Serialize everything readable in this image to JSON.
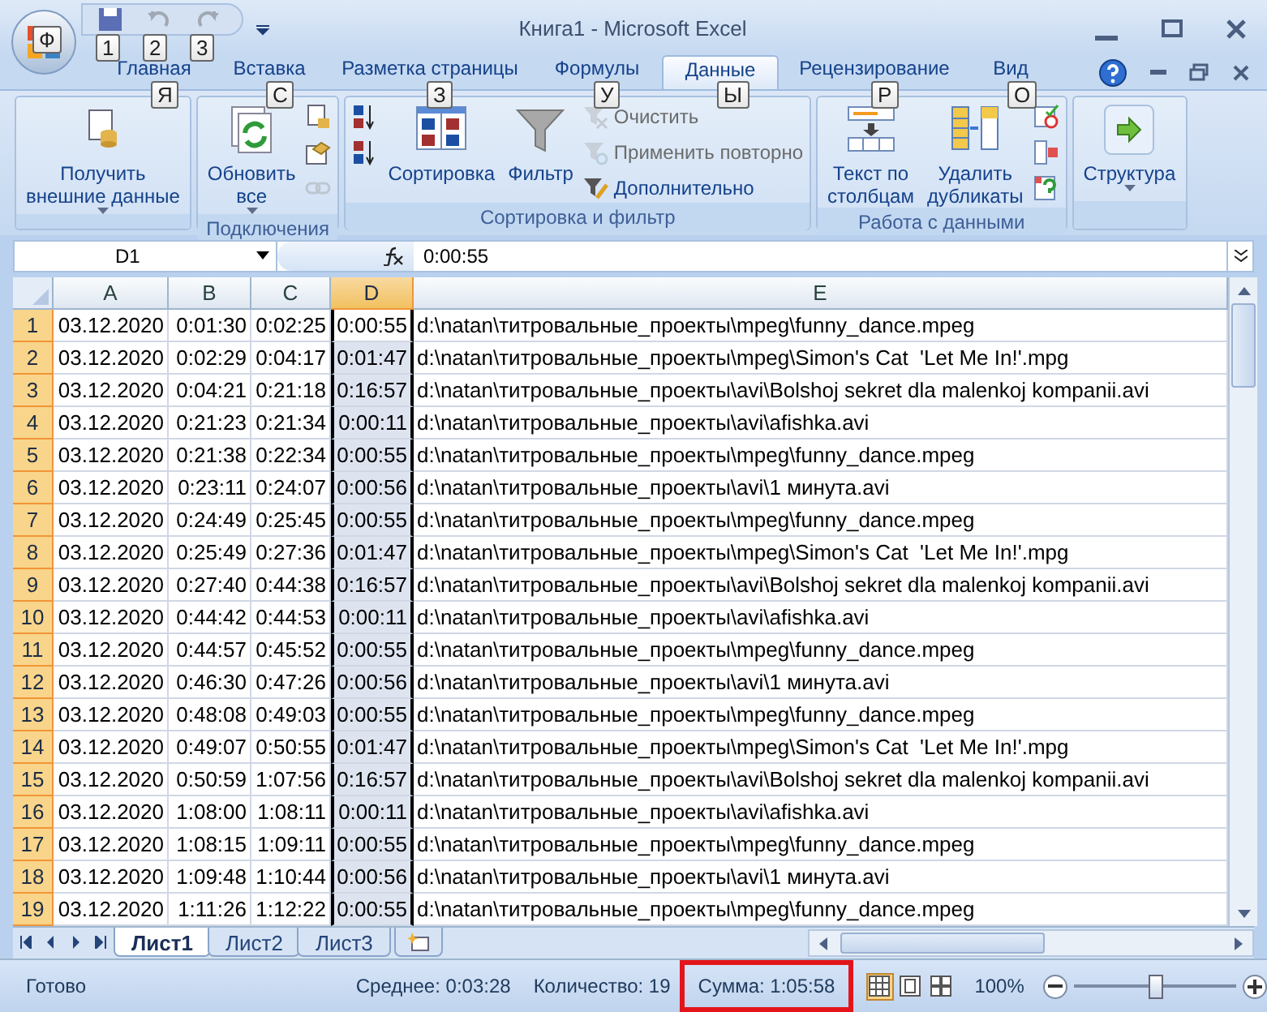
{
  "app_button": {
    "keytip": "Ф"
  },
  "quick_access": [
    {
      "keytip": "1",
      "disabled": false
    },
    {
      "keytip": "2",
      "disabled": true
    },
    {
      "keytip": "3",
      "disabled": true
    }
  ],
  "title": "Книга1 - Microsoft Excel",
  "tabs": [
    {
      "label": "Главная",
      "selected": false,
      "keytip": "Я"
    },
    {
      "label": "Вставка",
      "selected": false,
      "keytip": "С"
    },
    {
      "label": "Разметка страницы",
      "selected": false,
      "keytip": "З"
    },
    {
      "label": "Формулы",
      "selected": false,
      "keytip": "У"
    },
    {
      "label": "Данные",
      "selected": true,
      "keytip": "Ы"
    },
    {
      "label": "Рецензирование",
      "selected": false,
      "keytip": "Р"
    },
    {
      "label": "Вид",
      "selected": false,
      "keytip": "О"
    }
  ],
  "ribbon_groups": [
    {
      "items": [
        {
          "kind": "large",
          "label": "Получить\nвнешние данные",
          "dropdown": true,
          "disabled": false
        }
      ]
    },
    {
      "label": "Подключения",
      "items": [
        {
          "kind": "large",
          "label": "Обновить\nвсе",
          "dropdown": true,
          "disabled": false
        },
        {
          "kind": "icon",
          "disabled": false
        },
        {
          "kind": "icon",
          "disabled": false
        },
        {
          "kind": "icon",
          "disabled": true
        }
      ]
    },
    {
      "label": "Сортировка и фильтр",
      "items": [
        {
          "kind": "icon",
          "disabled": false
        },
        {
          "kind": "icon",
          "disabled": false
        },
        {
          "kind": "large",
          "label": "Сортировка",
          "disabled": false
        },
        {
          "kind": "large",
          "label": "Фильтр",
          "disabled": false
        },
        {
          "kind": "small",
          "label": "Очистить",
          "disabled": true
        },
        {
          "kind": "small",
          "label": "Применить повторно",
          "disabled": true
        },
        {
          "kind": "small",
          "label": "Дополнительно",
          "disabled": false
        }
      ]
    },
    {
      "label": "Работа с данными",
      "items": [
        {
          "kind": "large",
          "label": "Текст по\nстолбцам",
          "disabled": false
        },
        {
          "kind": "large",
          "label": "Удалить\nдубликаты",
          "disabled": false
        },
        {
          "kind": "icon",
          "disabled": false
        },
        {
          "kind": "icon",
          "disabled": false
        },
        {
          "kind": "icon",
          "disabled": false
        }
      ]
    },
    {
      "items": [
        {
          "kind": "large",
          "label": "Структура",
          "dropdown": true,
          "disabled": false
        }
      ]
    }
  ],
  "name_box": "D1",
  "formula": "0:00:55",
  "columns": [
    {
      "label": "A",
      "selected": false
    },
    {
      "label": "B",
      "selected": false
    },
    {
      "label": "C",
      "selected": false
    },
    {
      "label": "D",
      "selected": true
    },
    {
      "label": "E",
      "selected": false
    }
  ],
  "rows": [
    {
      "header": "1",
      "selected": true,
      "cells": [
        "03.12.2020",
        "0:01:30",
        "0:02:25",
        "0:00:55",
        "d:\\natan\\титровальные_проекты\\mpeg\\funny_dance.mpeg"
      ]
    },
    {
      "header": "2",
      "selected": true,
      "cells": [
        "03.12.2020",
        "0:02:29",
        "0:04:17",
        "0:01:47",
        "d:\\natan\\титровальные_проекты\\mpeg\\Simon's Cat  'Let Me In!'.mpg"
      ]
    },
    {
      "header": "3",
      "selected": true,
      "cells": [
        "03.12.2020",
        "0:04:21",
        "0:21:18",
        "0:16:57",
        "d:\\natan\\титровальные_проекты\\avi\\Bolshoj sekret dla malenkoj kompanii.avi"
      ]
    },
    {
      "header": "4",
      "selected": true,
      "cells": [
        "03.12.2020",
        "0:21:23",
        "0:21:34",
        "0:00:11",
        "d:\\natan\\титровальные_проекты\\avi\\afishka.avi"
      ]
    },
    {
      "header": "5",
      "selected": true,
      "cells": [
        "03.12.2020",
        "0:21:38",
        "0:22:34",
        "0:00:55",
        "d:\\natan\\титровальные_проекты\\mpeg\\funny_dance.mpeg"
      ]
    },
    {
      "header": "6",
      "selected": true,
      "cells": [
        "03.12.2020",
        "0:23:11",
        "0:24:07",
        "0:00:56",
        "d:\\natan\\титровальные_проекты\\avi\\1 минута.avi"
      ]
    },
    {
      "header": "7",
      "selected": true,
      "cells": [
        "03.12.2020",
        "0:24:49",
        "0:25:45",
        "0:00:55",
        "d:\\natan\\титровальные_проекты\\mpeg\\funny_dance.mpeg"
      ]
    },
    {
      "header": "8",
      "selected": true,
      "cells": [
        "03.12.2020",
        "0:25:49",
        "0:27:36",
        "0:01:47",
        "d:\\natan\\титровальные_проекты\\mpeg\\Simon's Cat  'Let Me In!'.mpg"
      ]
    },
    {
      "header": "9",
      "selected": true,
      "cells": [
        "03.12.2020",
        "0:27:40",
        "0:44:38",
        "0:16:57",
        "d:\\natan\\титровальные_проекты\\avi\\Bolshoj sekret dla malenkoj kompanii.avi"
      ]
    },
    {
      "header": "10",
      "selected": true,
      "cells": [
        "03.12.2020",
        "0:44:42",
        "0:44:53",
        "0:00:11",
        "d:\\natan\\титровальные_проекты\\avi\\afishka.avi"
      ]
    },
    {
      "header": "11",
      "selected": true,
      "cells": [
        "03.12.2020",
        "0:44:57",
        "0:45:52",
        "0:00:55",
        "d:\\natan\\титровальные_проекты\\mpeg\\funny_dance.mpeg"
      ]
    },
    {
      "header": "12",
      "selected": true,
      "cells": [
        "03.12.2020",
        "0:46:30",
        "0:47:26",
        "0:00:56",
        "d:\\natan\\титровальные_проекты\\avi\\1 минута.avi"
      ]
    },
    {
      "header": "13",
      "selected": true,
      "cells": [
        "03.12.2020",
        "0:48:08",
        "0:49:03",
        "0:00:55",
        "d:\\natan\\титровальные_проекты\\mpeg\\funny_dance.mpeg"
      ]
    },
    {
      "header": "14",
      "selected": true,
      "cells": [
        "03.12.2020",
        "0:49:07",
        "0:50:55",
        "0:01:47",
        "d:\\natan\\титровальные_проекты\\mpeg\\Simon's Cat  'Let Me In!'.mpg"
      ]
    },
    {
      "header": "15",
      "selected": true,
      "cells": [
        "03.12.2020",
        "0:50:59",
        "1:07:56",
        "0:16:57",
        "d:\\natan\\титровальные_проекты\\avi\\Bolshoj sekret dla malenkoj kompanii.avi"
      ]
    },
    {
      "header": "16",
      "selected": true,
      "cells": [
        "03.12.2020",
        "1:08:00",
        "1:08:11",
        "0:00:11",
        "d:\\natan\\титровальные_проекты\\avi\\afishka.avi"
      ]
    },
    {
      "header": "17",
      "selected": true,
      "cells": [
        "03.12.2020",
        "1:08:15",
        "1:09:11",
        "0:00:55",
        "d:\\natan\\титровальные_проекты\\mpeg\\funny_dance.mpeg"
      ]
    },
    {
      "header": "18",
      "selected": true,
      "cells": [
        "03.12.2020",
        "1:09:48",
        "1:10:44",
        "0:00:56",
        "d:\\natan\\титровальные_проекты\\avi\\1 минута.avi"
      ]
    },
    {
      "header": "19",
      "selected": true,
      "cells": [
        "03.12.2020",
        "1:11:26",
        "1:12:22",
        "0:00:55",
        "d:\\natan\\титровальные_проекты\\mpeg\\funny_dance.mpeg"
      ]
    }
  ],
  "sheet_tabs": [
    {
      "label": "Лист1",
      "selected": true
    },
    {
      "label": "Лист2",
      "selected": false
    },
    {
      "label": "Лист3",
      "selected": false
    }
  ],
  "status_bar": {
    "ready": "Готово",
    "stats": [
      {
        "text": "Среднее: 0:03:28",
        "highlighted": false
      },
      {
        "text": "Количество: 19",
        "highlighted": false
      },
      {
        "text": "Сумма: 1:05:58",
        "highlighted": true
      }
    ],
    "views": [
      {
        "selected": true
      },
      {
        "selected": false
      },
      {
        "selected": false
      }
    ],
    "zoom": "100%",
    "zoom_slider": {
      "level": 0.5
    }
  }
}
